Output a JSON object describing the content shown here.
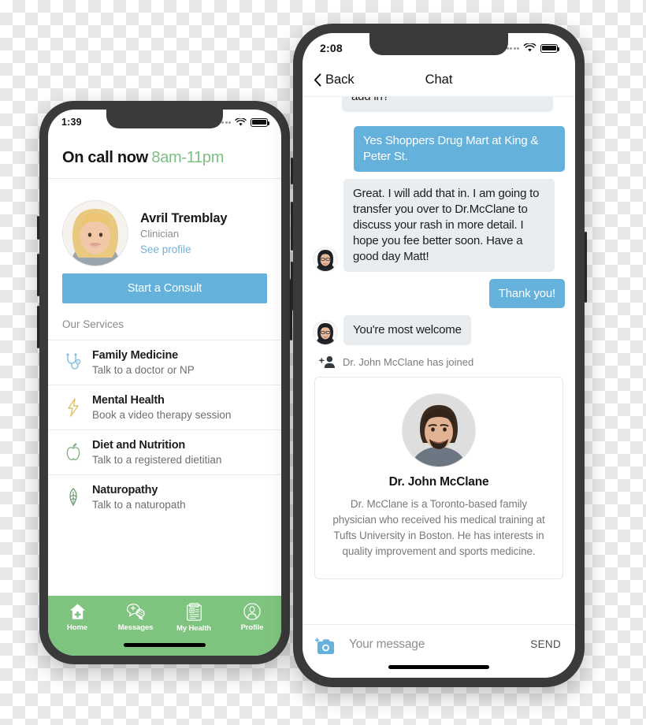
{
  "left_phone": {
    "status": {
      "time": "1:39",
      "wifi_icon": "wifi-icon",
      "battery_icon": "battery-icon",
      "signal_icon": "signal-dots-icon"
    },
    "header": {
      "title": "On call now",
      "hours": "8am-11pm"
    },
    "clinician": {
      "name": "Avril Tremblay",
      "role": "Clinician",
      "profile_link": "See profile",
      "avatar_icon": "clinician-avatar"
    },
    "consult_button": "Start a Consult",
    "services_label": "Our Services",
    "services": [
      {
        "title": "Family Medicine",
        "subtitle": "Talk to a doctor or NP",
        "icon": "stethoscope-icon",
        "color": "#8cc1dd"
      },
      {
        "title": "Mental Health",
        "subtitle": "Book a video therapy session",
        "icon": "lightning-bolt-icon",
        "color": "#e0c06a"
      },
      {
        "title": "Diet and Nutrition",
        "subtitle": "Talk to a registered dietitian",
        "icon": "apple-icon",
        "color": "#7fae86"
      },
      {
        "title": "Naturopathy",
        "subtitle": "Talk to a naturopath",
        "icon": "leaf-icon",
        "color": "#6f9e78"
      }
    ],
    "tabs": [
      {
        "label": "Home",
        "icon": "home-plus-icon"
      },
      {
        "label": "Messages",
        "icon": "chat-bubbles-icon"
      },
      {
        "label": "My Health",
        "icon": "clipboard-icon"
      },
      {
        "label": "Profile",
        "icon": "person-circle-icon"
      }
    ],
    "tabbar_color": "#7fc47e"
  },
  "right_phone": {
    "status": {
      "time": "2:08",
      "wifi_icon": "wifi-icon",
      "battery_icon": "battery-icon",
      "signal_icon": "signal-dots-icon"
    },
    "navbar": {
      "back_label": "Back",
      "back_icon": "chevron-left-icon",
      "title": "Chat"
    },
    "messages": [
      {
        "id": "m0",
        "side": "in",
        "clipped": true,
        "text": "add in?",
        "avatar": false
      },
      {
        "id": "m1",
        "side": "out",
        "text": "Yes Shoppers Drug Mart at King & Peter St.",
        "avatar": false
      },
      {
        "id": "m2",
        "side": "in",
        "text": "Great. I will add that in. I am going to transfer you over to Dr.McClane to discuss your rash in more detail. I hope you fee better soon. Have a good day Matt!",
        "avatar": true
      },
      {
        "id": "m3",
        "side": "out",
        "text": "Thank you!",
        "avatar": false
      },
      {
        "id": "m4",
        "side": "in",
        "text": "You're most welcome",
        "avatar": true
      }
    ],
    "system_event": {
      "text": "Dr. John McClane has joined",
      "icon": "person-add-icon"
    },
    "doctor_card": {
      "name": "Dr. John McClane",
      "bio": "Dr. McClane is a Toronto-based family physician who received his medical training at Tufts University in Boston. He has interests in quality improvement and sports medicine.",
      "avatar_icon": "doctor-avatar"
    },
    "composer": {
      "camera_icon": "camera-add-icon",
      "placeholder": "Your message",
      "send_label": "SEND"
    },
    "bubble_out_color": "#64b1db",
    "bubble_in_color": "#e9edf0"
  }
}
